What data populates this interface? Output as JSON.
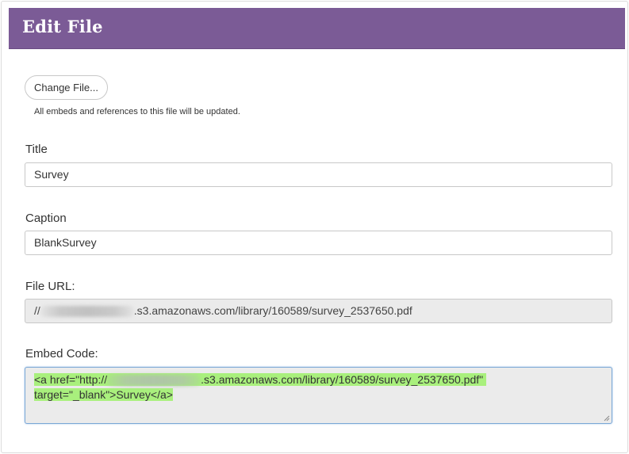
{
  "header": {
    "title": "Edit File"
  },
  "file": {
    "change_button_label": "Change File...",
    "note": "All embeds and references to this file will be updated."
  },
  "title_field": {
    "label": "Title",
    "value": "Survey"
  },
  "caption_field": {
    "label": "Caption",
    "value": "BlankSurvey"
  },
  "url_field": {
    "label": "File URL:",
    "prefix": "//",
    "suffix": ".s3.amazonaws.com/library/160589/survey_2537650.pdf"
  },
  "embed_field": {
    "label": "Embed Code:",
    "line1_prefix": "<a href=\"http://",
    "line1_suffix": ".s3.amazonaws.com/library/160589/survey_2537650.pdf\"",
    "line2": "target=\"_blank\">Survey</a>"
  },
  "colors": {
    "header_bg": "#7b5b96",
    "selection_highlight": "#a9f07d",
    "readonly_bg": "#ebebeb"
  }
}
